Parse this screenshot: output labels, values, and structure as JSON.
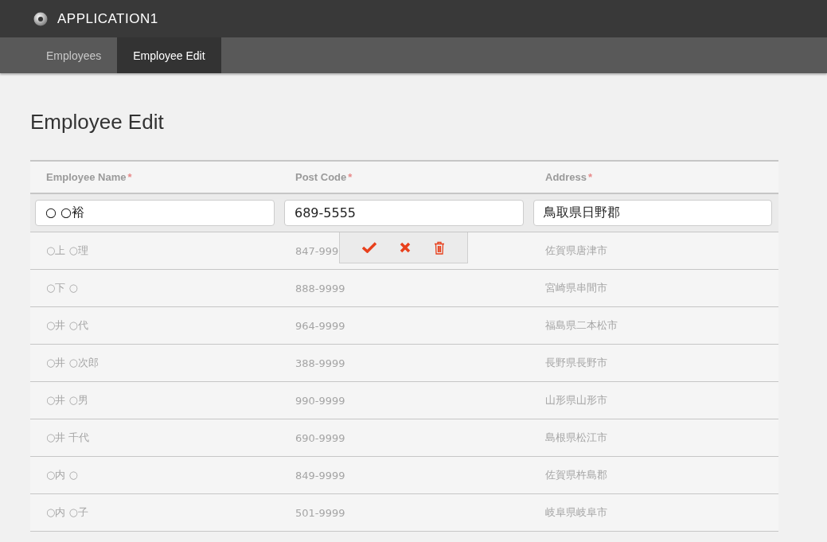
{
  "app": {
    "title": "APPLICATION1"
  },
  "tabs": [
    {
      "label": "Employees",
      "selected": false
    },
    {
      "label": "Employee Edit",
      "selected": true
    }
  ],
  "page_title": "Employee Edit",
  "table": {
    "columns": [
      {
        "label": "Employee Name",
        "required_mark": "*"
      },
      {
        "label": "Post Code",
        "required_mark": "*"
      },
      {
        "label": "Address",
        "required_mark": "*"
      }
    ],
    "edit_row": {
      "name": "○ ○裕",
      "post_code": "689-5555",
      "address": "鳥取県日野郡"
    },
    "rows": [
      {
        "name": "○上 ○理",
        "post_code": "847-999",
        "address": "佐賀県唐津市"
      },
      {
        "name": "○下 ○",
        "post_code": "888-9999",
        "address": "宮崎県串間市"
      },
      {
        "name": "○井 ○代",
        "post_code": "964-9999",
        "address": "福島県二本松市"
      },
      {
        "name": "○井 ○次郎",
        "post_code": "388-9999",
        "address": "長野県長野市"
      },
      {
        "name": "○井 ○男",
        "post_code": "990-9999",
        "address": "山形県山形市"
      },
      {
        "name": "○井 千代",
        "post_code": "690-9999",
        "address": "島根県松江市"
      },
      {
        "name": "○内 ○",
        "post_code": "849-9999",
        "address": "佐賀県杵島郡"
      },
      {
        "name": "○内 ○子",
        "post_code": "501-9999",
        "address": "岐阜県岐阜市"
      }
    ]
  }
}
